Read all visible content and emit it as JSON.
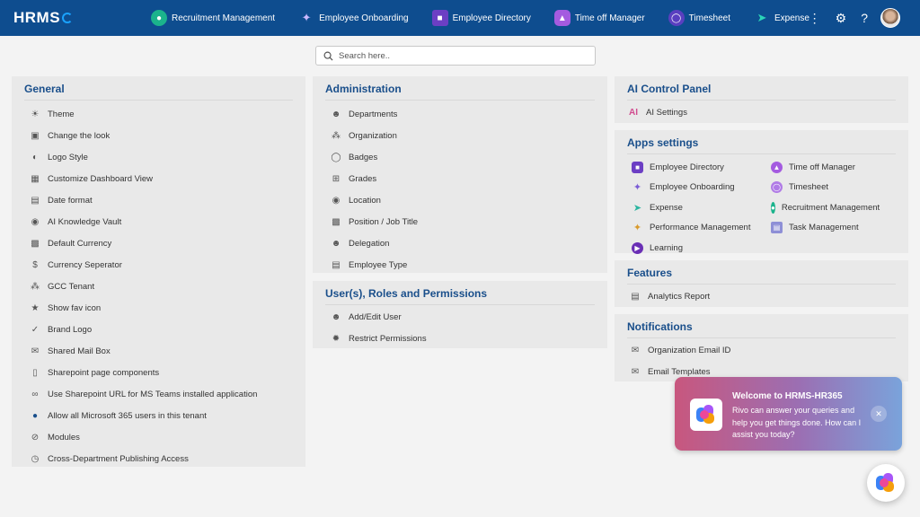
{
  "app": {
    "logo_text": "HRMS"
  },
  "nav": {
    "items": [
      {
        "label": "Recruitment Management",
        "icon": "recruitment-icon",
        "color": "#1bb38c"
      },
      {
        "label": "Employee Onboarding",
        "icon": "onboarding-icon",
        "color": "#7b5cd6"
      },
      {
        "label": "Employee Directory",
        "icon": "directory-icon",
        "color": "#6c3fc4"
      },
      {
        "label": "Time off Manager",
        "icon": "timeoff-icon",
        "color": "#a45be0"
      },
      {
        "label": "Timesheet",
        "icon": "timesheet-icon",
        "color": "#5a3fc0"
      },
      {
        "label": "Expense",
        "icon": "expense-icon",
        "color": "#2bb5a0"
      }
    ]
  },
  "search": {
    "placeholder": "Search here.."
  },
  "general": {
    "title": "General",
    "items": [
      {
        "label": "Theme",
        "icon": "theme-icon"
      },
      {
        "label": "Change the look",
        "icon": "change-look-icon"
      },
      {
        "label": "Logo Style",
        "icon": "logo-style-icon"
      },
      {
        "label": "Customize Dashboard View",
        "icon": "dashboard-icon"
      },
      {
        "label": "Date format",
        "icon": "calendar-icon"
      },
      {
        "label": "AI Knowledge Vault",
        "icon": "vault-icon"
      },
      {
        "label": "Default Currency",
        "icon": "currency-icon"
      },
      {
        "label": "Currency Seperator",
        "icon": "dollar-icon"
      },
      {
        "label": "GCC Tenant",
        "icon": "tenant-icon"
      },
      {
        "label": "Show fav icon",
        "icon": "favicon-icon"
      },
      {
        "label": "Brand Logo",
        "icon": "brand-icon"
      },
      {
        "label": "Shared Mail Box",
        "icon": "mailbox-icon"
      },
      {
        "label": "Sharepoint page components",
        "icon": "sharepoint-icon"
      },
      {
        "label": "Use Sharepoint URL for MS Teams installed application",
        "icon": "link-icon"
      },
      {
        "label": "Allow all Microsoft 365 users in this tenant",
        "icon": "users-icon"
      },
      {
        "label": "Modules",
        "icon": "modules-icon"
      },
      {
        "label": "Cross-Department Publishing Access",
        "icon": "publish-icon"
      }
    ]
  },
  "administration": {
    "title": "Administration",
    "items": [
      {
        "label": "Departments",
        "icon": "departments-icon"
      },
      {
        "label": "Organization",
        "icon": "organization-icon"
      },
      {
        "label": "Badges",
        "icon": "badge-icon"
      },
      {
        "label": "Grades",
        "icon": "grades-icon"
      },
      {
        "label": "Location",
        "icon": "location-icon"
      },
      {
        "label": "Position / Job Title",
        "icon": "position-icon"
      },
      {
        "label": "Delegation",
        "icon": "delegation-icon"
      },
      {
        "label": "Employee Type",
        "icon": "employee-type-icon"
      }
    ]
  },
  "roles": {
    "title": "User(s), Roles and Permissions",
    "items": [
      {
        "label": "Add/Edit User",
        "icon": "add-user-icon"
      },
      {
        "label": "Restrict Permissions",
        "icon": "restrict-icon"
      }
    ]
  },
  "ai_panel": {
    "title": "AI Control Panel",
    "items": [
      {
        "label": "AI Settings",
        "icon": "ai-icon"
      }
    ]
  },
  "apps_settings": {
    "title": "Apps settings",
    "items": [
      {
        "label": "Employee Directory",
        "icon": "directory-icon",
        "color": "#6c3fc4"
      },
      {
        "label": "Time off Manager",
        "icon": "timeoff-icon",
        "color": "#a45be0"
      },
      {
        "label": "Employee Onboarding",
        "icon": "onboarding-icon",
        "color": "#7b5cd6"
      },
      {
        "label": "Timesheet",
        "icon": "timesheet-icon",
        "color": "#b07be6"
      },
      {
        "label": "Expense",
        "icon": "expense-icon",
        "color": "#2bb5a0"
      },
      {
        "label": "Recruitment Management",
        "icon": "recruitment-icon",
        "color": "#1bb38c"
      },
      {
        "label": "Performance Management",
        "icon": "performance-icon",
        "color": "#d99a2b"
      },
      {
        "label": "Task Management",
        "icon": "task-icon",
        "color": "#8e8fd6"
      },
      {
        "label": "Learning",
        "icon": "learning-icon",
        "color": "#6a2fb5"
      }
    ]
  },
  "features": {
    "title": "Features",
    "items": [
      {
        "label": "Analytics Report",
        "icon": "analytics-icon"
      }
    ]
  },
  "notifications": {
    "title": "Notifications",
    "items": [
      {
        "label": "Organization Email ID",
        "icon": "org-email-icon"
      },
      {
        "label": "Email Templates",
        "icon": "email-icon"
      }
    ]
  },
  "popup": {
    "title": "Welcome to HRMS-HR365",
    "message": "Rivo can answer your queries and help you get things done. How can I assist you today?"
  }
}
